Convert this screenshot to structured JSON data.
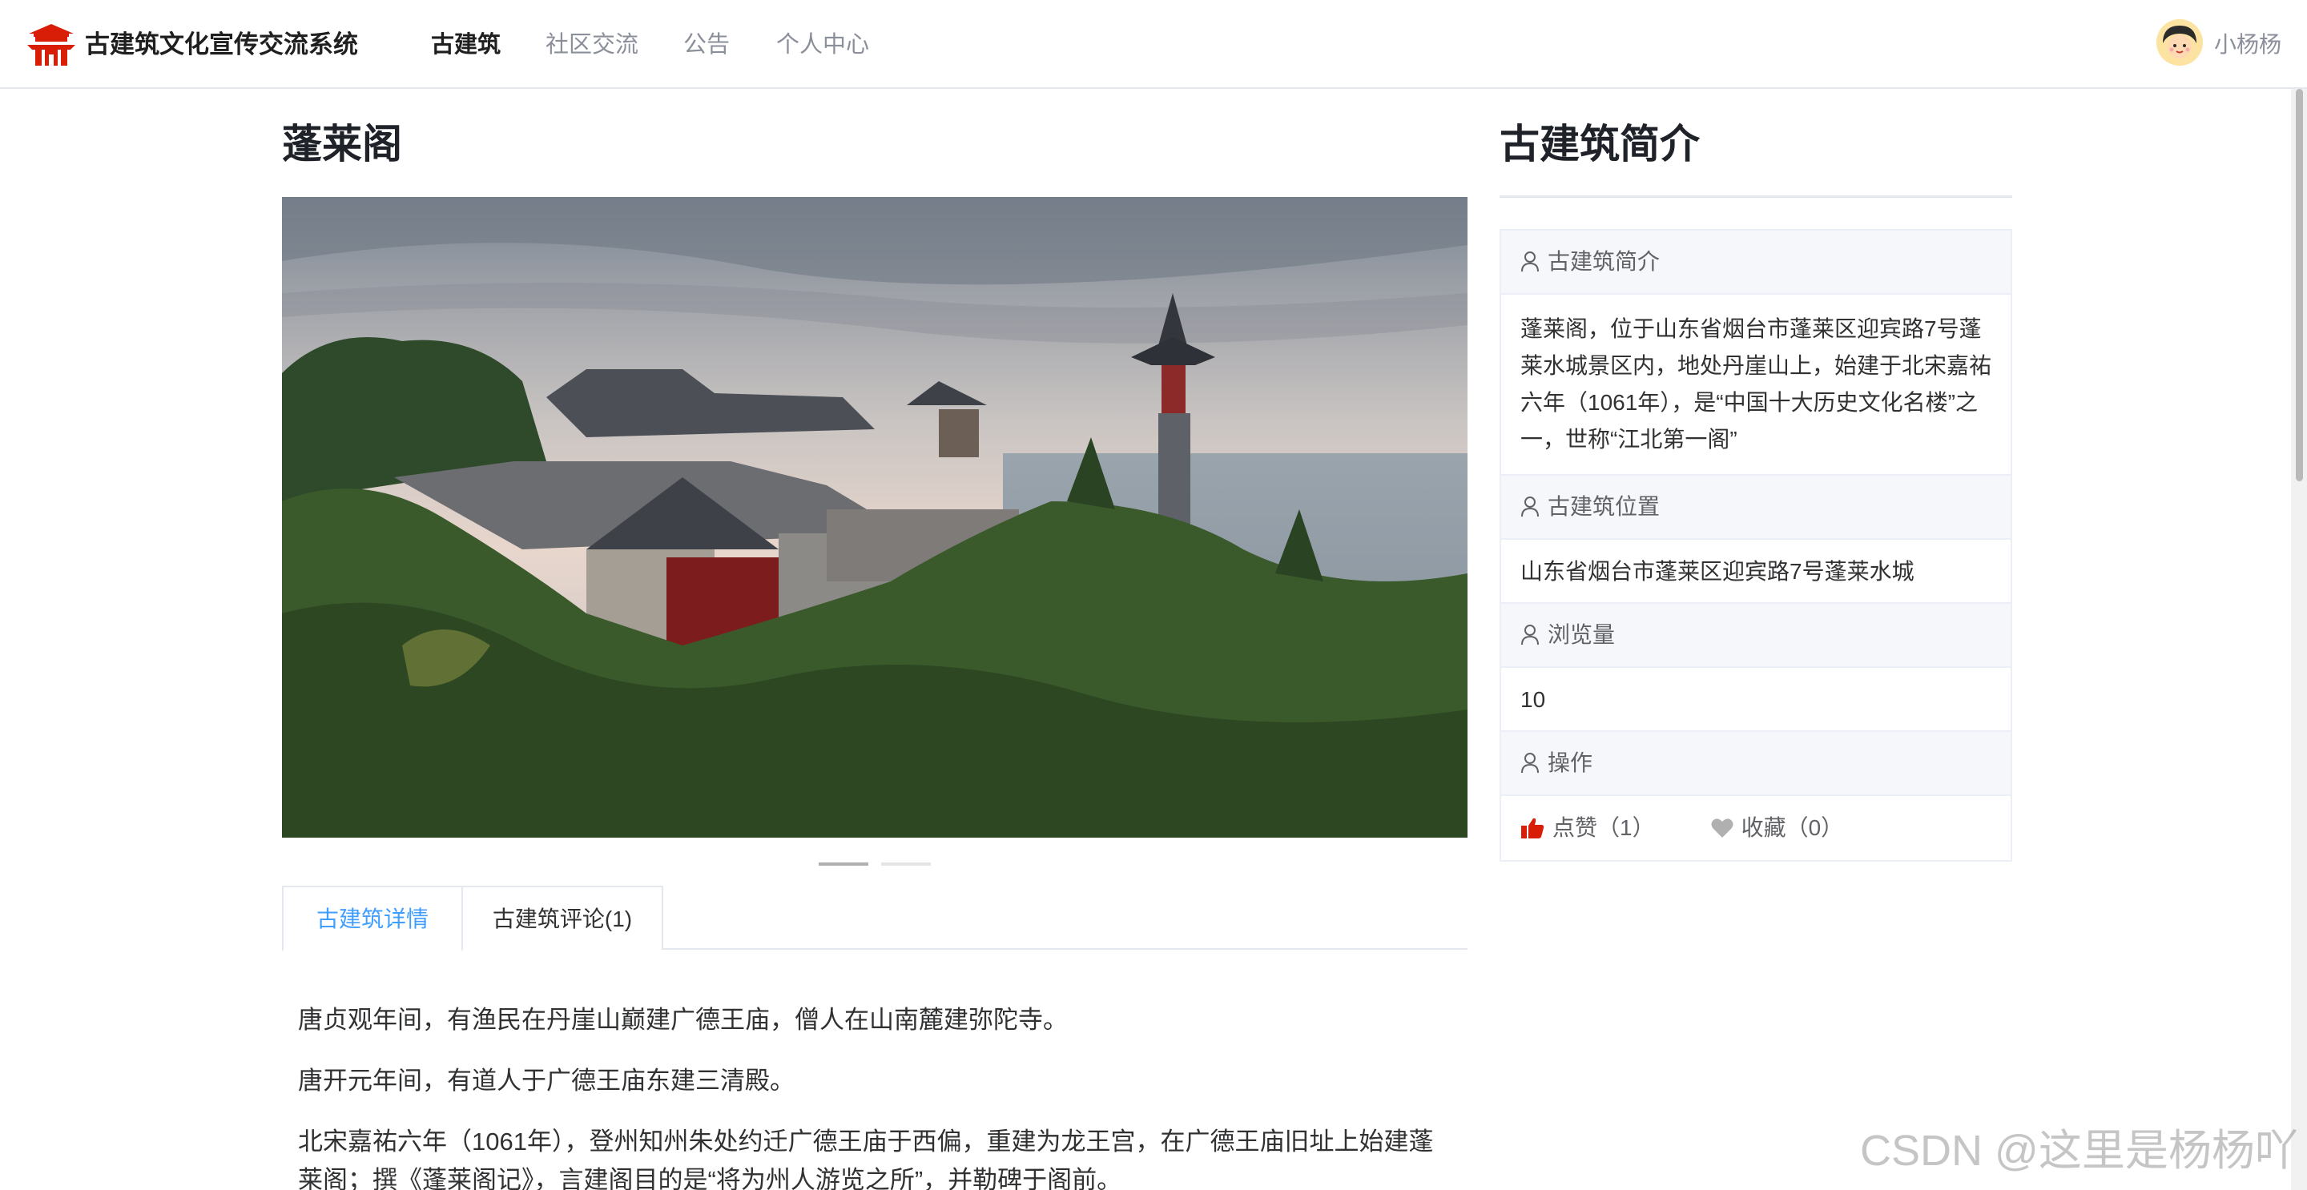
{
  "header": {
    "logo_icon": "pagoda-logo-icon",
    "site_title": "古建筑文化宣传交流系统",
    "nav": [
      "古建筑",
      "社区交流",
      "公告",
      "个人中心"
    ],
    "active_nav": "古建筑",
    "username": "小杨杨",
    "accent_color": "#d81e06"
  },
  "building": {
    "name": "蓬莱阁",
    "image_alt": "蓬莱阁",
    "carousel_count": 2,
    "carousel_active": 1
  },
  "tabs": [
    "古建筑详情",
    "古建筑评论(1)"
  ],
  "active_tab": "古建筑详情",
  "detail_paragraphs": [
    "唐贞观年间，有渔民在丹崖山巅建广德王庙，僧人在山南麓建弥陀寺。",
    "唐开元年间，有道人于广德王庙东建三清殿。",
    "北宋嘉祐六年（1061年），登州知州朱处约迁广德王庙于西偏，重建为龙王宫，在广德王庙旧址上始建蓬莱阁；撰《蓬莱阁记》，言建阁目的是“将为州人游览之所”，并勒碑于阁前。"
  ],
  "sidebar": {
    "title": "古建筑简介",
    "labels": {
      "intro": "古建筑简介",
      "location": "古建筑位置",
      "views": "浏览量",
      "actions": "操作"
    },
    "intro": "蓬莱阁，位于山东省烟台市蓬莱区迎宾路7号蓬莱水城景区内，地处丹崖山上，始建于北宋嘉祐六年（1061年），是“中国十大历史文化名楼”之一，世称“江北第一阁”",
    "location": "山东省烟台市蓬莱区迎宾路7号蓬莱水城",
    "views": "10",
    "like_label": "点赞（1）",
    "favorite_label": "收藏（0）",
    "like_color": "#d81e06",
    "favorite_color": "#b0b0b0"
  },
  "watermark": "CSDN @这里是杨杨吖",
  "colors": {
    "link_blue": "#409eff",
    "border": "#ebeef5",
    "label_bg": "#f5f7fa"
  }
}
